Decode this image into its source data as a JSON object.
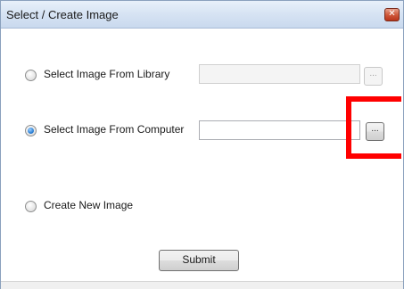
{
  "window": {
    "title": "Select / Create Image"
  },
  "options": [
    {
      "label": "Select Image From Library",
      "checked": false,
      "field_value": "",
      "field_enabled": false,
      "browse_label": "..."
    },
    {
      "label": "Select Image From Computer",
      "checked": true,
      "field_value": "",
      "field_enabled": true,
      "browse_label": "..."
    },
    {
      "label": "Create New Image",
      "checked": false
    }
  ],
  "actions": {
    "submit_label": "Submit"
  },
  "colors": {
    "highlight": "#ff0000",
    "title_bar": "#d6e3f3"
  },
  "icons": {
    "close": "close-icon"
  }
}
